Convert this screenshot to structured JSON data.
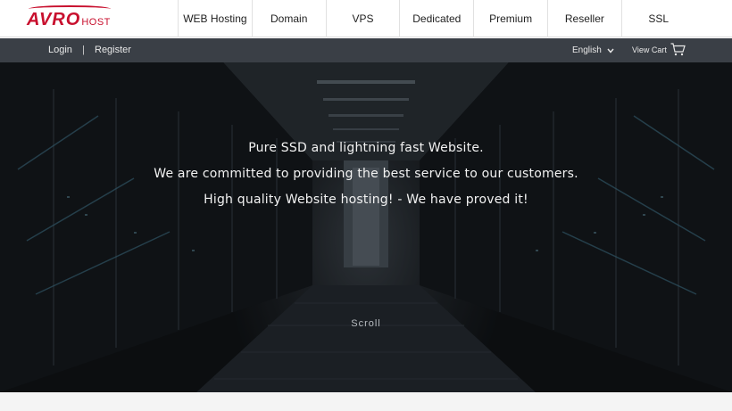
{
  "brand": {
    "logo_main": "AVRO",
    "logo_sub": "HOST"
  },
  "nav": {
    "items": [
      {
        "label": "WEB Hosting"
      },
      {
        "label": "Domain"
      },
      {
        "label": "VPS"
      },
      {
        "label": "Dedicated"
      },
      {
        "label": "Premium"
      },
      {
        "label": "Reseller"
      },
      {
        "label": "SSL"
      }
    ]
  },
  "subbar": {
    "login": "Login",
    "separator": "|",
    "register": "Register",
    "language": "English",
    "cart": "View Cart"
  },
  "hero": {
    "line1": "Pure SSD and lightning fast Website.",
    "line2": "We are committed to providing the best service to our customers.",
    "line3": "High quality Website hosting! - We have proved it!",
    "scroll": "Scroll"
  },
  "colors": {
    "brand": "#c8102e",
    "subbar_bg": "#3a3f46"
  },
  "icons": {
    "language": "chevron-down-icon",
    "cart": "cart-icon"
  }
}
